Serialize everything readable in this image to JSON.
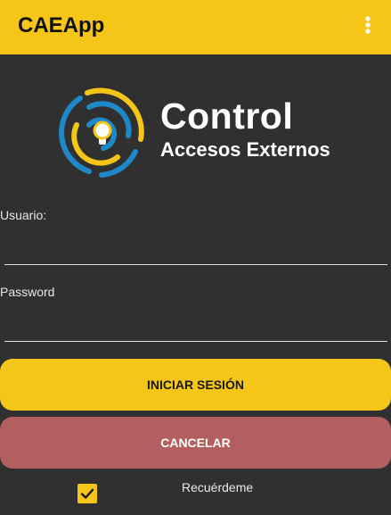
{
  "appbar": {
    "title": "CAEApp",
    "menu_icon": "more-vert-icon"
  },
  "logo": {
    "title": "Control",
    "subtitle": "Accesos Externos",
    "icon": "keyhole-rings-icon"
  },
  "form": {
    "username_label": "Usuario:",
    "username_value": "",
    "password_label": "Password",
    "password_value": "",
    "login_label": "INICIAR SESIÓN",
    "cancel_label": "CANCELAR",
    "remember_label": "Recuérdeme",
    "remember_checked": true
  },
  "colors": {
    "accent": "#F5C518",
    "background": "#303030",
    "cancel": "#B45F5F",
    "logo_blue": "#1E88C9"
  }
}
